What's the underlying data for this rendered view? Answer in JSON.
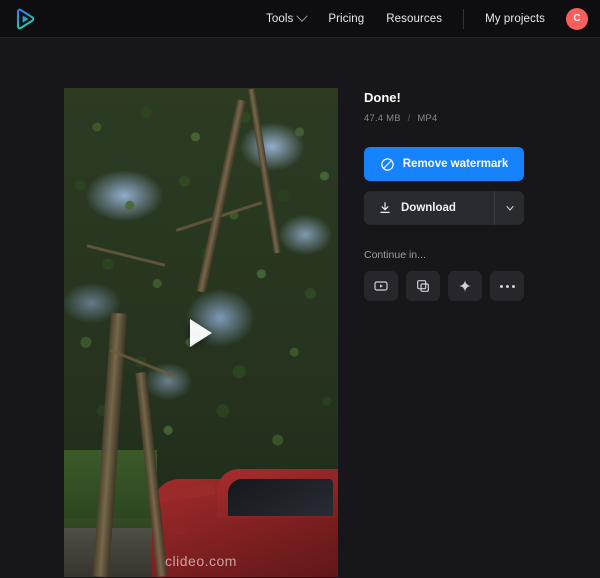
{
  "header": {
    "logo_icon": "clideo-play-logo",
    "nav": [
      {
        "label": "Tools",
        "icon": "chevron-down-icon",
        "has_chevron": true
      },
      {
        "label": "Pricing",
        "has_chevron": false
      },
      {
        "label": "Resources",
        "has_chevron": false
      }
    ],
    "my_projects_label": "My projects",
    "avatar": {
      "initial": "C",
      "color": "#f8605e"
    }
  },
  "video": {
    "watermark": "clideo.com",
    "play_icon": "play-icon"
  },
  "panel": {
    "title": "Done!",
    "file_size": "47.4 MB",
    "separator": "/",
    "file_format": "MP4",
    "remove_watermark_label": "Remove watermark",
    "remove_watermark_icon": "no-watermark-icon",
    "remove_watermark_color": "#1682fb",
    "download_label": "Download",
    "download_icon": "download-icon",
    "download_caret_icon": "chevron-down-icon",
    "continue_label": "Continue in...",
    "continue_actions": [
      {
        "name": "video-player-icon",
        "title": "Video editor"
      },
      {
        "name": "duplicate-icon",
        "title": "Duplicate"
      },
      {
        "name": "sparkle-icon",
        "title": "AI tools"
      },
      {
        "name": "more-options-icon",
        "title": "More"
      }
    ]
  }
}
